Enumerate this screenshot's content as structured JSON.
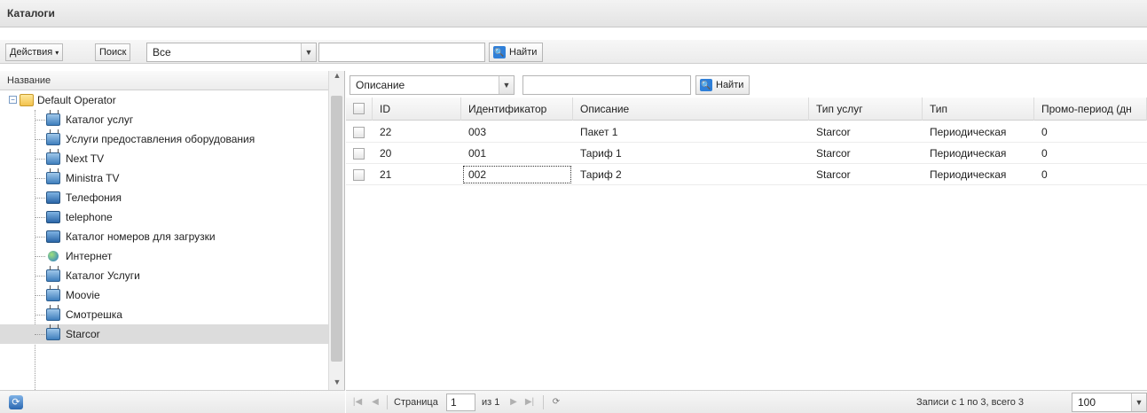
{
  "window": {
    "title": "Каталоги"
  },
  "toolbar": {
    "actions_label": "Действия",
    "search_label": "Поиск",
    "filter_select_value": "Все",
    "search_input_value": "",
    "find_button_label": "Найти"
  },
  "tree": {
    "column_header": "Название",
    "root": "Default Operator",
    "items": [
      {
        "label": "Каталог услуг",
        "icon": "tv-icon"
      },
      {
        "label": "Услуги предоставления оборудования",
        "icon": "tv-icon"
      },
      {
        "label": "Next TV",
        "icon": "tv-icon"
      },
      {
        "label": "Ministra TV",
        "icon": "tv-icon"
      },
      {
        "label": "Телефония",
        "icon": "phone-icon"
      },
      {
        "label": "telephone",
        "icon": "phone-icon"
      },
      {
        "label": "Каталог номеров для загрузки",
        "icon": "phone-icon"
      },
      {
        "label": "Интернет",
        "icon": "globe-icon"
      },
      {
        "label": "Каталог Услуги",
        "icon": "tv-icon"
      },
      {
        "label": "Moovie",
        "icon": "tv-icon"
      },
      {
        "label": "Смотрешка",
        "icon": "tv-icon"
      },
      {
        "label": "Starcor",
        "icon": "tv-icon"
      }
    ],
    "selected": "Starcor"
  },
  "grid_toolbar": {
    "field_select_value": "Описание",
    "search_input_value": "",
    "find_button_label": "Найти"
  },
  "grid": {
    "columns": [
      "ID",
      "Идентификатор",
      "Описание",
      "Тип услуг",
      "Тип",
      "Промо-период (дн"
    ],
    "rows": [
      [
        "22",
        "003",
        "Пакет 1",
        "Starcor",
        "Периодическая",
        "0"
      ],
      [
        "20",
        "001",
        "Тариф 1",
        "Starcor",
        "Периодическая",
        "0"
      ],
      [
        "21",
        "002",
        "Тариф 2",
        "Starcor",
        "Периодическая",
        "0"
      ]
    ]
  },
  "pager": {
    "page_label": "Страница",
    "page_value": "1",
    "of_label": "из 1",
    "records_label": "Записи с 1 по 3, всего 3",
    "page_size": "100"
  },
  "colors": {
    "accent": "#2f7fd8",
    "selected_row": "#dcdcdc",
    "header_bg": "#ececec"
  }
}
